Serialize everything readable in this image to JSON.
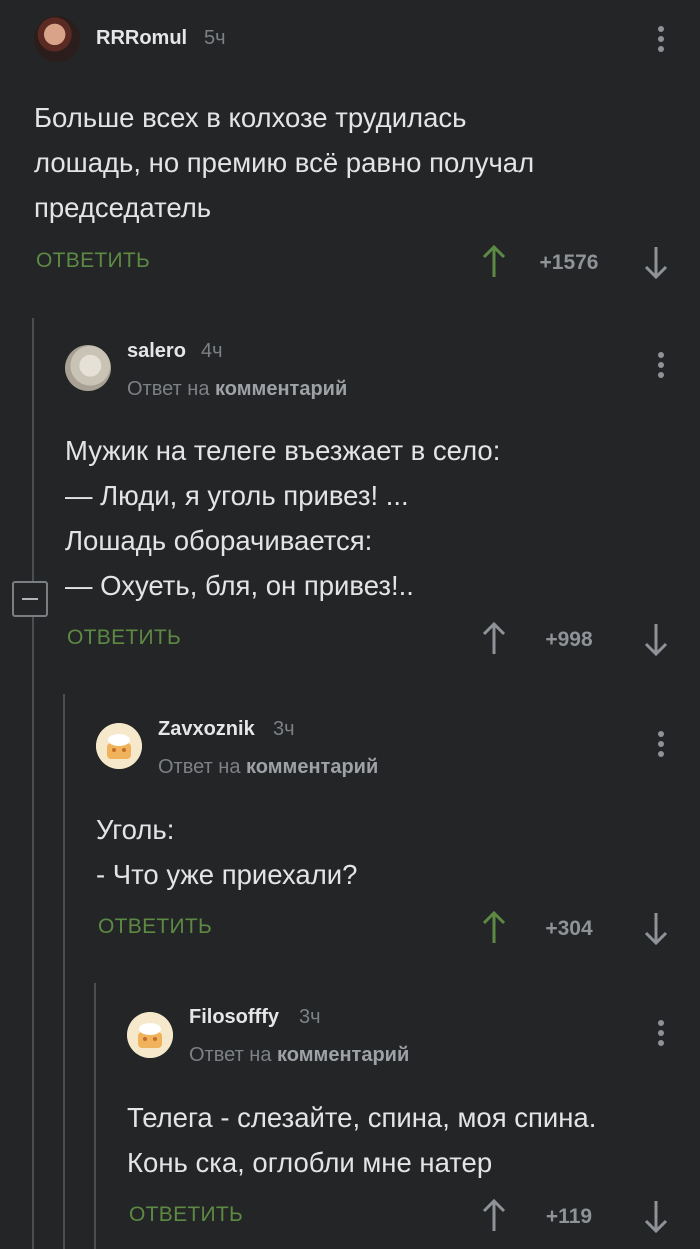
{
  "comments": [
    {
      "username": "RRRomul",
      "time": "5ч",
      "text": "Больше всех в колхозе трудилась\nлошадь,  но премию всё равно получал\nпредседатель",
      "reply_label": "ОТВЕТИТЬ",
      "score": "+1576",
      "upvoted": true
    },
    {
      "username": "salero",
      "time": "4ч",
      "reply_prefix": "Ответ на ",
      "reply_target": "комментарий",
      "text": "Мужик на телеге въезжает в село:\n— Люди, я уголь привез! ...\nЛошадь оборачивается:\n— Охуеть, бля, он привез!..",
      "reply_label": "ОТВЕТИТЬ",
      "score": "+998",
      "upvoted": false
    },
    {
      "username": "Zavxoznik",
      "time": "3ч",
      "reply_prefix": "Ответ на ",
      "reply_target": "комментарий",
      "text": "Уголь:\n- Что уже приехали?",
      "reply_label": "ОТВЕТИТЬ",
      "score": "+304",
      "upvoted": true
    },
    {
      "username": "Filosofffy",
      "time": "3ч",
      "reply_prefix": "Ответ на ",
      "reply_target": "комментарий",
      "text": "Телега - слезайте, спина, моя спина.\nКонь ска, оглобли мне натер",
      "reply_label": "ОТВЕТИТЬ",
      "score": "+119",
      "upvoted": false
    }
  ],
  "colors": {
    "background": "#232527",
    "accent_green": "#5d8a43",
    "muted": "#7d8085"
  },
  "icons": [
    "avatar",
    "more-vertical-icon",
    "arrow-up-icon",
    "arrow-down-icon",
    "collapse-icon"
  ]
}
